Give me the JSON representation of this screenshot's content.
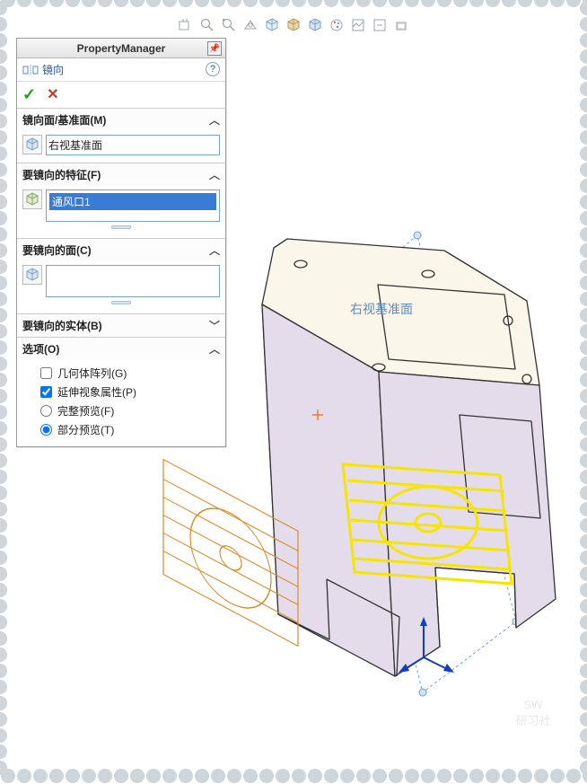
{
  "panel": {
    "title": "PropertyManager",
    "feature_name": "镜向",
    "sections": {
      "mirror_plane": {
        "label": "镜向面/基准面(M)",
        "value": "右视基准面"
      },
      "features": {
        "label": "要镜向的特征(F)",
        "selected": "通风口1"
      },
      "faces": {
        "label": "要镜向的面(C)"
      },
      "bodies": {
        "label": "要镜向的实体(B)"
      },
      "options": {
        "label": "选项(O)",
        "geometry_pattern": {
          "label": "几何体阵列(G)",
          "checked": false
        },
        "propagate_visual": {
          "label": "延伸视象属性(P)",
          "checked": true
        },
        "full_preview": {
          "label": "完整预览(F)",
          "selected": false
        },
        "partial_preview": {
          "label": "部分预览(T)",
          "selected": true
        }
      }
    }
  },
  "viewport": {
    "plane_label": "右视基准面"
  },
  "watermark": {
    "l1": "SW",
    "l2": "研习社"
  }
}
